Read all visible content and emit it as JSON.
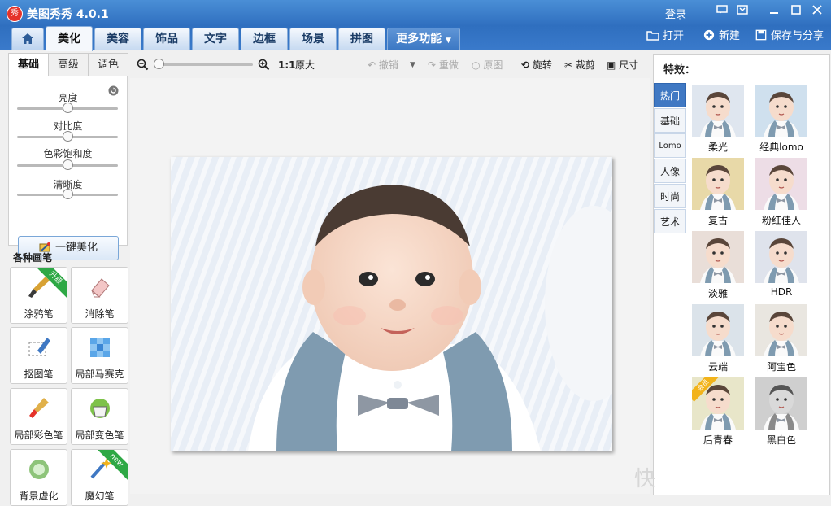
{
  "app": {
    "title": "美图秀秀 4.0.1",
    "logo_char": "秀",
    "login": "登录"
  },
  "tabs": {
    "home_icon": "home-icon",
    "items": [
      "美化",
      "美容",
      "饰品",
      "文字",
      "边框",
      "场景",
      "拼图"
    ],
    "more": "更多功能"
  },
  "top_actions": {
    "open": "打开",
    "new": "新建",
    "save_share": "保存与分享"
  },
  "left": {
    "subtabs": [
      "基础",
      "高级",
      "调色"
    ],
    "adjustments": [
      {
        "label": "亮度",
        "value": 0.5
      },
      {
        "label": "对比度",
        "value": 0.5
      },
      {
        "label": "色彩饱和度",
        "value": 0.5
      },
      {
        "label": "清晰度",
        "value": 0.5
      }
    ],
    "one_key": "一键美化",
    "brushes_title": "各种画笔",
    "tools": [
      {
        "label": "涂鸦笔",
        "badge": "升级"
      },
      {
        "label": "消除笔",
        "badge": ""
      },
      {
        "label": "抠图笔",
        "badge": ""
      },
      {
        "label": "局部马赛克",
        "badge": ""
      },
      {
        "label": "局部彩色笔",
        "badge": ""
      },
      {
        "label": "局部变色笔",
        "badge": ""
      },
      {
        "label": "背景虚化",
        "badge": ""
      },
      {
        "label": "魔幻笔",
        "badge": "new"
      }
    ]
  },
  "toolbar": {
    "ratio": "1:1",
    "original_size": "原大",
    "undo": "撤销",
    "redo": "重做",
    "original": "原图",
    "rotate": "旋转",
    "crop": "裁剪",
    "size": "尺寸",
    "zoom_level": 0.0
  },
  "right": {
    "title": "特效：",
    "categories": [
      "热门",
      "基础",
      "Lomo",
      "人像",
      "时尚",
      "艺术"
    ],
    "effects": [
      {
        "label": "柔光",
        "tint": "#dfe6ef",
        "badge": ""
      },
      {
        "label": "经典lomo",
        "tint": "#cfe0ee",
        "badge": ""
      },
      {
        "label": "复古",
        "tint": "#e8d9a8",
        "badge": ""
      },
      {
        "label": "粉红佳人",
        "tint": "#eddde6",
        "badge": ""
      },
      {
        "label": "淡雅",
        "tint": "#e9ded8",
        "badge": ""
      },
      {
        "label": "HDR",
        "tint": "#dfe3ec",
        "badge": ""
      },
      {
        "label": "云端",
        "tint": "#dbe3ea",
        "badge": ""
      },
      {
        "label": "阿宝色",
        "tint": "#e9e6e0",
        "badge": ""
      },
      {
        "label": "后青春",
        "tint": "#e8e6c9",
        "badge": "会员"
      },
      {
        "label": "黑白色",
        "tint": "#cfcfcf",
        "badge": ""
      }
    ]
  },
  "watermark": "快",
  "colors": {
    "accent": "#2f6fbf",
    "active_category": "#3f78c3"
  }
}
